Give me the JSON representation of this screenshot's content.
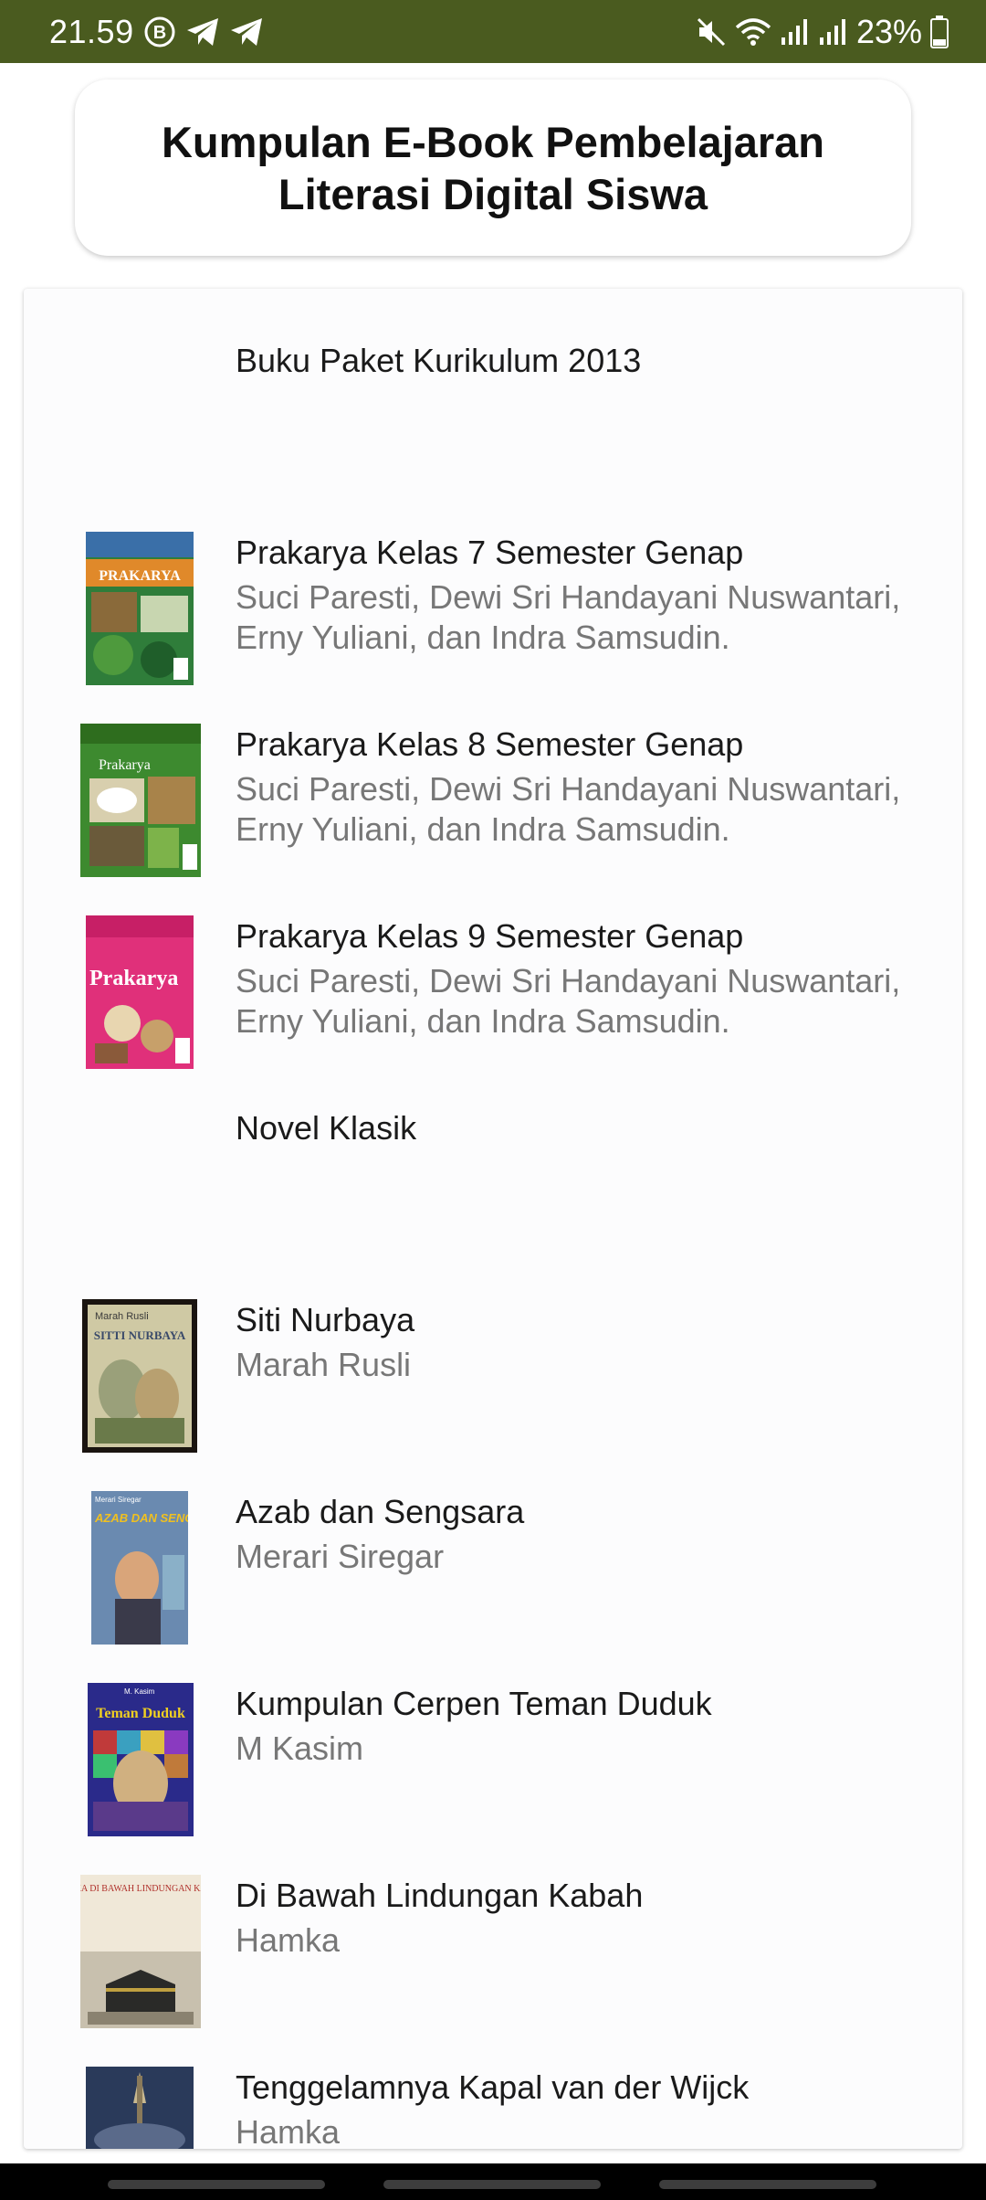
{
  "status_bar": {
    "time": "21.59",
    "battery": "23%",
    "icons": [
      "b-circle-icon",
      "telegram-icon",
      "telegram-icon",
      "mute-icon",
      "wifi-icon",
      "signal-icon",
      "signal-icon",
      "battery-icon"
    ]
  },
  "header": {
    "title": "Kumpulan E-Book Pembelajaran Literasi Digital Siswa"
  },
  "list": {
    "items": [
      {
        "title": "Buku Paket Kurikulum 2013",
        "author": ""
      },
      {
        "title": "Prakarya Kelas 7 Semester Genap",
        "author": "Suci Paresti, Dewi Sri Handayani Nuswantari, Erny Yuliani, dan Indra Samsudin.",
        "cover_text": "PRAKARYA"
      },
      {
        "title": "Prakarya Kelas 8 Semester Genap",
        "author": "Suci Paresti, Dewi Sri Handayani Nuswantari, Erny Yuliani, dan Indra Samsudin.",
        "cover_text": "Prakarya"
      },
      {
        "title": "Prakarya Kelas 9 Semester Genap",
        "author": "Suci Paresti, Dewi Sri Handayani Nuswantari, Erny Yuliani, dan Indra Samsudin.",
        "cover_text": "Prakarya"
      },
      {
        "title": "Novel Klasik",
        "author": ""
      },
      {
        "title": "Siti Nurbaya",
        "author": "Marah Rusli",
        "cover_text": "SITTI NURBAYA",
        "cover_subtext": "Marah Rusli"
      },
      {
        "title": "Azab dan Sengsara",
        "author": "Merari Siregar",
        "cover_text": "AZAB DAN SENGSARA",
        "cover_subtext": "Merari Siregar"
      },
      {
        "title": "Kumpulan Cerpen Teman Duduk",
        "author": "M Kasim",
        "cover_text": "Teman Duduk",
        "cover_subtext": "M. Kasim"
      },
      {
        "title": "Di Bawah Lindungan Kabah",
        "author": "Hamka",
        "cover_text": "HAMKA DI BAWAH LINDUNGAN KA'BAH"
      },
      {
        "title": "Tenggelamnya Kapal van der Wijck",
        "author": "Hamka"
      }
    ]
  }
}
